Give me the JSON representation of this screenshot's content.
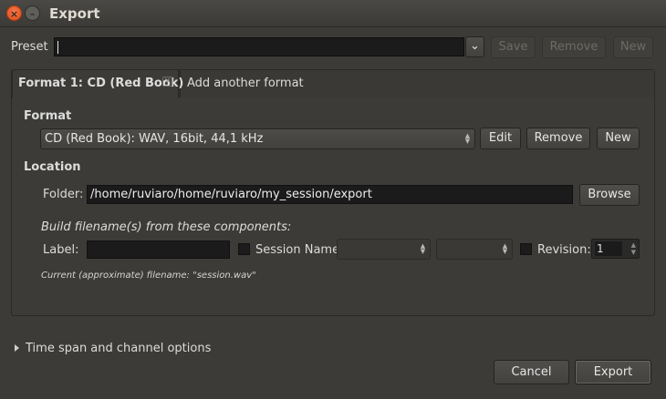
{
  "window": {
    "title": "Export",
    "close_glyph": "×",
    "min_glyph": "–"
  },
  "preset": {
    "label": "Preset",
    "value": "",
    "dropdown_glyph": "⌄",
    "save_label": "Save",
    "remove_label": "Remove",
    "new_label": "New"
  },
  "tabs": {
    "active_label": "Format 1: CD (Red Book)",
    "close_glyph": "×",
    "add_label": "Add another format"
  },
  "format": {
    "section_label": "Format",
    "selected": "CD (Red Book): WAV, 16bit, 44,1 kHz",
    "edit_label": "Edit",
    "remove_label": "Remove",
    "new_label": "New"
  },
  "location": {
    "section_label": "Location",
    "folder_label": "Folder:",
    "folder_value": "/home/ruviaro/home/ruviaro/my_session/export",
    "browse_label": "Browse"
  },
  "filename": {
    "heading": "Build filename(s) from these components:",
    "label_label": "Label:",
    "label_value": "",
    "session_name_label": "Session Name",
    "session_name_checked": false,
    "date_value": "",
    "time_value": "",
    "revision_label": "Revision:",
    "revision_checked": false,
    "revision_value": "1",
    "current_filename": "Current (approximate) filename: \"session.wav\""
  },
  "timespan": {
    "label": "Time span and channel options"
  },
  "actions": {
    "cancel_label": "Cancel",
    "export_label": "Export"
  }
}
